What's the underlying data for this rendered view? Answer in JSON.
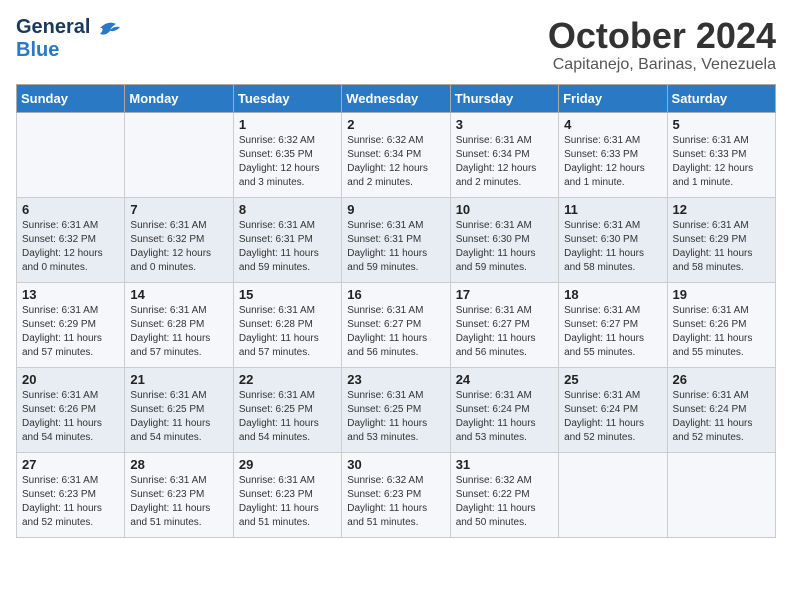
{
  "header": {
    "logo_general": "General",
    "logo_blue": "Blue",
    "month_title": "October 2024",
    "subtitle": "Capitanejo, Barinas, Venezuela"
  },
  "days_of_week": [
    "Sunday",
    "Monday",
    "Tuesday",
    "Wednesday",
    "Thursday",
    "Friday",
    "Saturday"
  ],
  "weeks": [
    [
      {
        "day": "",
        "info": ""
      },
      {
        "day": "",
        "info": ""
      },
      {
        "day": "1",
        "info": "Sunrise: 6:32 AM\nSunset: 6:35 PM\nDaylight: 12 hours and 3 minutes."
      },
      {
        "day": "2",
        "info": "Sunrise: 6:32 AM\nSunset: 6:34 PM\nDaylight: 12 hours and 2 minutes."
      },
      {
        "day": "3",
        "info": "Sunrise: 6:31 AM\nSunset: 6:34 PM\nDaylight: 12 hours and 2 minutes."
      },
      {
        "day": "4",
        "info": "Sunrise: 6:31 AM\nSunset: 6:33 PM\nDaylight: 12 hours and 1 minute."
      },
      {
        "day": "5",
        "info": "Sunrise: 6:31 AM\nSunset: 6:33 PM\nDaylight: 12 hours and 1 minute."
      }
    ],
    [
      {
        "day": "6",
        "info": "Sunrise: 6:31 AM\nSunset: 6:32 PM\nDaylight: 12 hours and 0 minutes."
      },
      {
        "day": "7",
        "info": "Sunrise: 6:31 AM\nSunset: 6:32 PM\nDaylight: 12 hours and 0 minutes."
      },
      {
        "day": "8",
        "info": "Sunrise: 6:31 AM\nSunset: 6:31 PM\nDaylight: 11 hours and 59 minutes."
      },
      {
        "day": "9",
        "info": "Sunrise: 6:31 AM\nSunset: 6:31 PM\nDaylight: 11 hours and 59 minutes."
      },
      {
        "day": "10",
        "info": "Sunrise: 6:31 AM\nSunset: 6:30 PM\nDaylight: 11 hours and 59 minutes."
      },
      {
        "day": "11",
        "info": "Sunrise: 6:31 AM\nSunset: 6:30 PM\nDaylight: 11 hours and 58 minutes."
      },
      {
        "day": "12",
        "info": "Sunrise: 6:31 AM\nSunset: 6:29 PM\nDaylight: 11 hours and 58 minutes."
      }
    ],
    [
      {
        "day": "13",
        "info": "Sunrise: 6:31 AM\nSunset: 6:29 PM\nDaylight: 11 hours and 57 minutes."
      },
      {
        "day": "14",
        "info": "Sunrise: 6:31 AM\nSunset: 6:28 PM\nDaylight: 11 hours and 57 minutes."
      },
      {
        "day": "15",
        "info": "Sunrise: 6:31 AM\nSunset: 6:28 PM\nDaylight: 11 hours and 57 minutes."
      },
      {
        "day": "16",
        "info": "Sunrise: 6:31 AM\nSunset: 6:27 PM\nDaylight: 11 hours and 56 minutes."
      },
      {
        "day": "17",
        "info": "Sunrise: 6:31 AM\nSunset: 6:27 PM\nDaylight: 11 hours and 56 minutes."
      },
      {
        "day": "18",
        "info": "Sunrise: 6:31 AM\nSunset: 6:27 PM\nDaylight: 11 hours and 55 minutes."
      },
      {
        "day": "19",
        "info": "Sunrise: 6:31 AM\nSunset: 6:26 PM\nDaylight: 11 hours and 55 minutes."
      }
    ],
    [
      {
        "day": "20",
        "info": "Sunrise: 6:31 AM\nSunset: 6:26 PM\nDaylight: 11 hours and 54 minutes."
      },
      {
        "day": "21",
        "info": "Sunrise: 6:31 AM\nSunset: 6:25 PM\nDaylight: 11 hours and 54 minutes."
      },
      {
        "day": "22",
        "info": "Sunrise: 6:31 AM\nSunset: 6:25 PM\nDaylight: 11 hours and 54 minutes."
      },
      {
        "day": "23",
        "info": "Sunrise: 6:31 AM\nSunset: 6:25 PM\nDaylight: 11 hours and 53 minutes."
      },
      {
        "day": "24",
        "info": "Sunrise: 6:31 AM\nSunset: 6:24 PM\nDaylight: 11 hours and 53 minutes."
      },
      {
        "day": "25",
        "info": "Sunrise: 6:31 AM\nSunset: 6:24 PM\nDaylight: 11 hours and 52 minutes."
      },
      {
        "day": "26",
        "info": "Sunrise: 6:31 AM\nSunset: 6:24 PM\nDaylight: 11 hours and 52 minutes."
      }
    ],
    [
      {
        "day": "27",
        "info": "Sunrise: 6:31 AM\nSunset: 6:23 PM\nDaylight: 11 hours and 52 minutes."
      },
      {
        "day": "28",
        "info": "Sunrise: 6:31 AM\nSunset: 6:23 PM\nDaylight: 11 hours and 51 minutes."
      },
      {
        "day": "29",
        "info": "Sunrise: 6:31 AM\nSunset: 6:23 PM\nDaylight: 11 hours and 51 minutes."
      },
      {
        "day": "30",
        "info": "Sunrise: 6:32 AM\nSunset: 6:23 PM\nDaylight: 11 hours and 51 minutes."
      },
      {
        "day": "31",
        "info": "Sunrise: 6:32 AM\nSunset: 6:22 PM\nDaylight: 11 hours and 50 minutes."
      },
      {
        "day": "",
        "info": ""
      },
      {
        "day": "",
        "info": ""
      }
    ]
  ]
}
